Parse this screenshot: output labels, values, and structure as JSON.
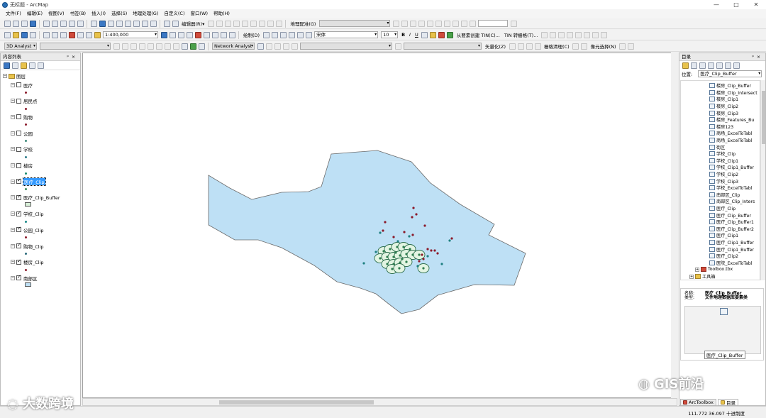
{
  "window": {
    "title": "无标题 - ArcMap",
    "controls": [
      "—",
      "□",
      "✕"
    ]
  },
  "menu": [
    "文件(F)",
    "编辑(E)",
    "视图(V)",
    "书签(B)",
    "插入(I)",
    "选择(S)",
    "地理处理(G)",
    "自定义(C)",
    "窗口(W)",
    "帮助(H)"
  ],
  "toolbar1": {
    "georef_label": "地理配准(G)"
  },
  "toolbar2": {
    "scale": "1:400,000",
    "draw_label": "绘制(D)",
    "font": "宋体",
    "font_size": "10",
    "bold": "B",
    "italic": "I",
    "underline": "U",
    "tin_create": "从要素创建 TIN(C)...",
    "tin_convert": "TIN 转栅格(T)..."
  },
  "toolbar3": {
    "analyst_3d": "3D Analyst",
    "network_analyst": "Network Analyst",
    "vectorize": "矢量化(Z)",
    "raster_clean": "栅格清理(C)",
    "select_element": "像元选择(N)"
  },
  "toc": {
    "title": "内容列表",
    "root": "图层",
    "layers": [
      {
        "name": "医疗",
        "checked": false,
        "symbol": "dot",
        "color": "#8b1a2a",
        "selected": false
      },
      {
        "name": "居民点",
        "checked": false,
        "symbol": "dot",
        "color": "#8b1a2a",
        "selected": false
      },
      {
        "name": "购物",
        "checked": false,
        "symbol": "dot",
        "color": "#8b1a2a",
        "selected": false
      },
      {
        "name": "公园",
        "checked": false,
        "symbol": "dot",
        "color": "#3d8a7a",
        "selected": false
      },
      {
        "name": "学校",
        "checked": false,
        "symbol": "dot",
        "color": "#2a7a8a",
        "selected": false
      },
      {
        "name": "楼房",
        "checked": false,
        "symbol": "dot",
        "color": "#1a8a6a",
        "selected": false
      },
      {
        "name": "医疗_Clip",
        "checked": true,
        "symbol": "dot",
        "color": "#3d8a5a",
        "selected": true
      },
      {
        "name": "医疗_Clip_Buffer",
        "checked": true,
        "symbol": "rect",
        "color": "#d8efd8",
        "selected": false
      },
      {
        "name": "学校_Clip",
        "checked": true,
        "symbol": "dot",
        "color": "#1a8a8a",
        "selected": false
      },
      {
        "name": "公园_Clip",
        "checked": true,
        "symbol": "dot",
        "color": "#8b1a2a",
        "selected": false
      },
      {
        "name": "购物_Clip",
        "checked": true,
        "symbol": "dot",
        "color": "#2a6a7a",
        "selected": false
      },
      {
        "name": "楼房_Clip",
        "checked": true,
        "symbol": "dot",
        "color": "#8b1a2a",
        "selected": false
      },
      {
        "name": "南部区",
        "checked": true,
        "symbol": "rect",
        "color": "#bee0f5",
        "selected": false
      }
    ]
  },
  "catalog": {
    "title": "目录",
    "location_label": "位置:",
    "location_value": "医疗_Clip_Buffer",
    "items": [
      "楼房_Clip_Buffer",
      "楼房_Clip_Intersect",
      "楼房_Clip1",
      "楼房_Clip2",
      "楼房_Clip3",
      "楼房_Features_Bu",
      "楼房123",
      "商场_ExcelToTabl",
      "商场_ExcelToTabl",
      "街区",
      "学校_Clip",
      "学校_Clip1",
      "学校_Clip1_Buffer",
      "学校_Clip2",
      "学校_Clip3",
      "学校_ExcelToTabl",
      "南部区_Clip",
      "南部区_Clip_Inters",
      "医疗_Clip",
      "医疗_Clip_Buffer",
      "医疗_Clip_Buffer1",
      "医疗_Clip_Buffer2",
      "医疗_Clip1",
      "医疗_Clip1_Buffer",
      "医疗_Clip1_Buffer",
      "医疗_Clip2",
      "医院_ExcelToTabl"
    ],
    "toolbox": "Toolbox.tbx",
    "tools_folder": "工具箱",
    "desc_name_label": "名称:",
    "desc_type_label": "类型:",
    "desc_name": "医疗_Clip_Buffer",
    "desc_type": "文件地理数据库要素类",
    "thumb_label": "医疗_Clip_Buffer",
    "tab_arctoolbox": "ArcToolbox",
    "tab_catalog": "目录"
  },
  "status": {
    "coords": "111.772  36.097 十进制度"
  },
  "watermarks": {
    "right": "GIS前沿",
    "left": "大数跨境"
  },
  "colors": {
    "region_fill": "#bee0f5",
    "region_stroke": "#6a6a6a",
    "buffer_fill": "#e3f5e3",
    "buffer_stroke": "#2d6e4e",
    "point_dark_red": "#8b1a2a",
    "point_teal": "#1e8080",
    "point_green": "#2e7d4f"
  }
}
